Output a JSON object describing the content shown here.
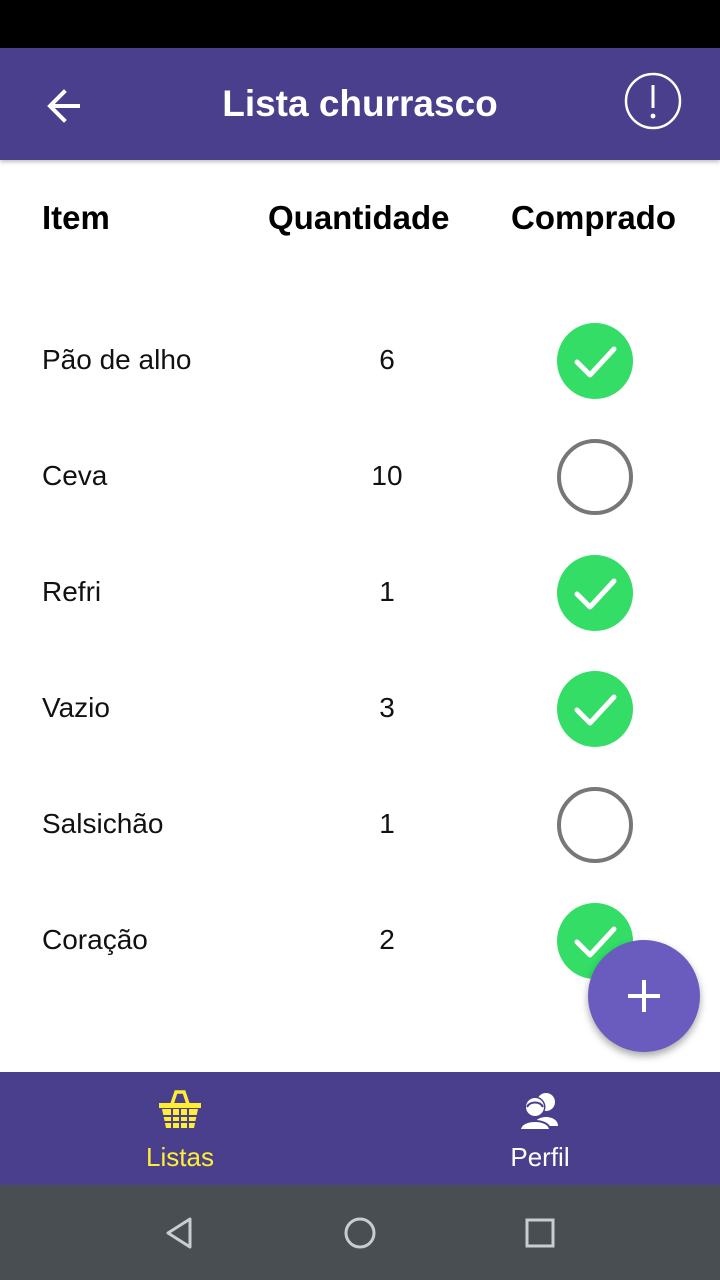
{
  "app_bar": {
    "title": "Lista churrasco"
  },
  "table": {
    "headers": {
      "item": "Item",
      "quantity": "Quantidade",
      "bought": "Comprado"
    },
    "rows": [
      {
        "name": "Pão de alho",
        "quantity": "6",
        "bought": true
      },
      {
        "name": "Ceva",
        "quantity": "10",
        "bought": false
      },
      {
        "name": "Refri",
        "quantity": "1",
        "bought": true
      },
      {
        "name": "Vazio",
        "quantity": "3",
        "bought": true
      },
      {
        "name": "Salsichão",
        "quantity": "1",
        "bought": false
      },
      {
        "name": "Coração",
        "quantity": "2",
        "bought": true
      }
    ]
  },
  "bottom_nav": {
    "items": [
      {
        "label": "Listas",
        "icon": "basket-icon",
        "active": true
      },
      {
        "label": "Perfil",
        "icon": "profile-icon",
        "active": false
      }
    ]
  },
  "colors": {
    "primary": "#4a3f8c",
    "fab": "#6a5bbf",
    "checked": "#33dd66",
    "active_nav": "#ffee33",
    "system_nav": "#484e52"
  }
}
